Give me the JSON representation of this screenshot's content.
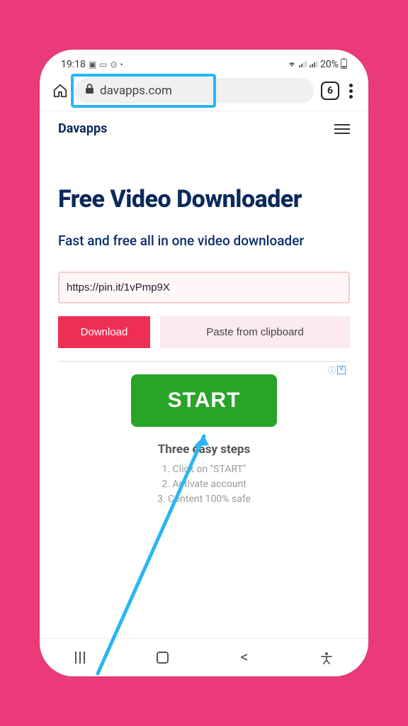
{
  "statusbar": {
    "time": "19:18",
    "battery": "20%"
  },
  "browser": {
    "url_display": "davapps.com",
    "tab_count": "6"
  },
  "site": {
    "brand": "Davapps",
    "title": "Free Video Downloader",
    "subtitle": "Fast and free all in one video downloader",
    "url_value": "https://pin.it/1vPmp9X",
    "download_label": "Download",
    "paste_label": "Paste from clipboard"
  },
  "ad": {
    "start_label": "START",
    "subtitle": "Three easy steps",
    "step1": "1. Click on \"START\"",
    "step2": "2. Activate account",
    "step3": "3. Content 100% safe",
    "info_mark": "ⓘ"
  }
}
